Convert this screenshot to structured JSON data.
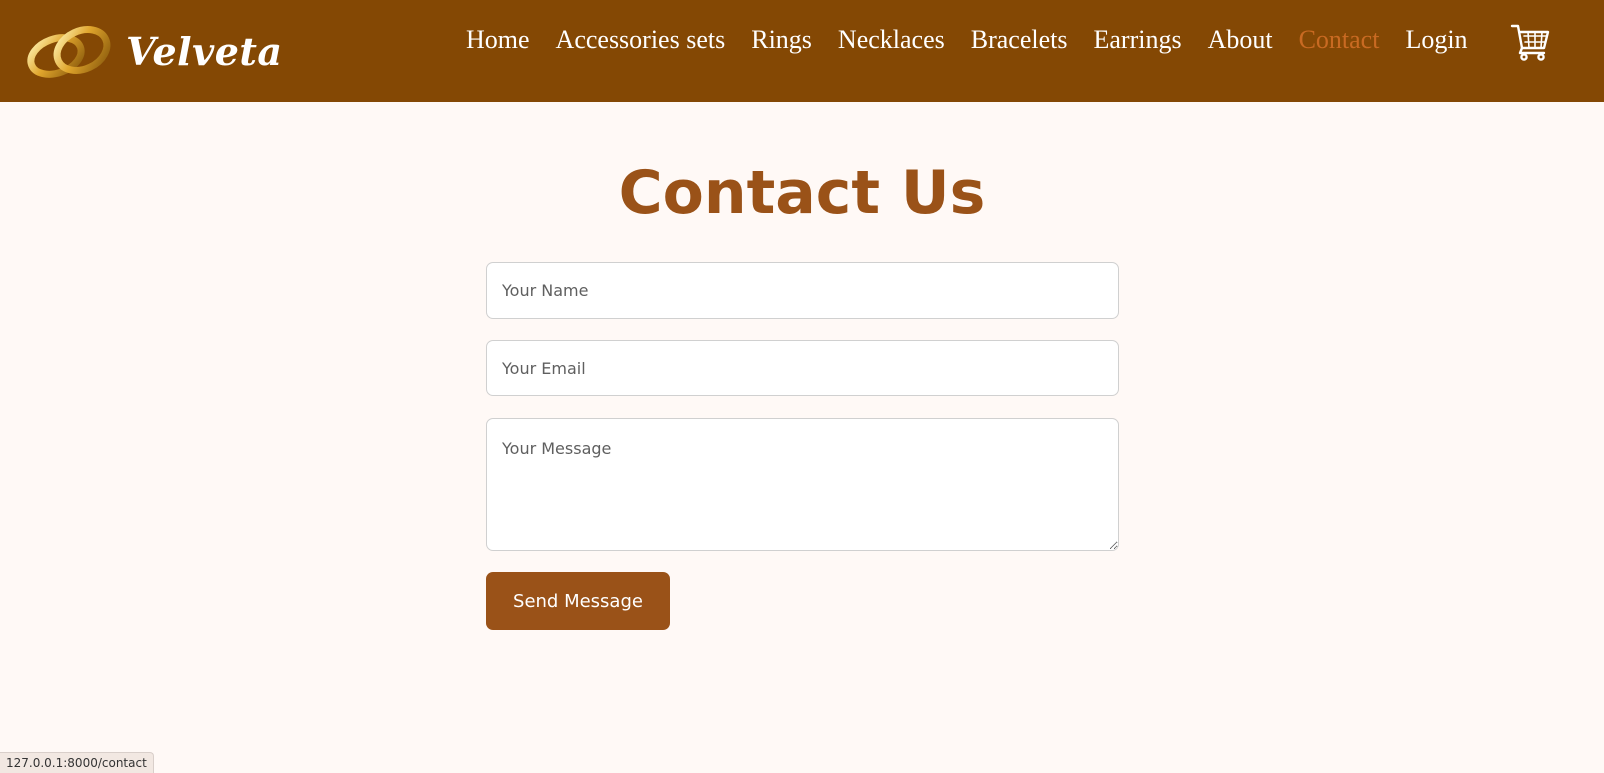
{
  "brand": {
    "name": "Velveta",
    "logo_icon": "wedding-rings-icon"
  },
  "nav": {
    "items": [
      {
        "label": "Home"
      },
      {
        "label": "Accessories sets"
      },
      {
        "label": "Rings"
      },
      {
        "label": "Necklaces"
      },
      {
        "label": "Bracelets"
      },
      {
        "label": "Earrings"
      },
      {
        "label": "About"
      },
      {
        "label": "Contact",
        "active": true
      },
      {
        "label": "Login"
      }
    ],
    "cart_icon": "shopping-cart-icon"
  },
  "page": {
    "title": "Contact Us"
  },
  "form": {
    "name_placeholder": "Your Name",
    "email_placeholder": "Your Email",
    "message_placeholder": "Your Message",
    "submit_label": "Send Message"
  },
  "status_bar": {
    "url": "127.0.0.1:8000/contact"
  },
  "colors": {
    "nav_bg": "#844804",
    "active_link": "#c96a22",
    "accent": "#9a5218",
    "page_bg": "#fff9f6"
  }
}
